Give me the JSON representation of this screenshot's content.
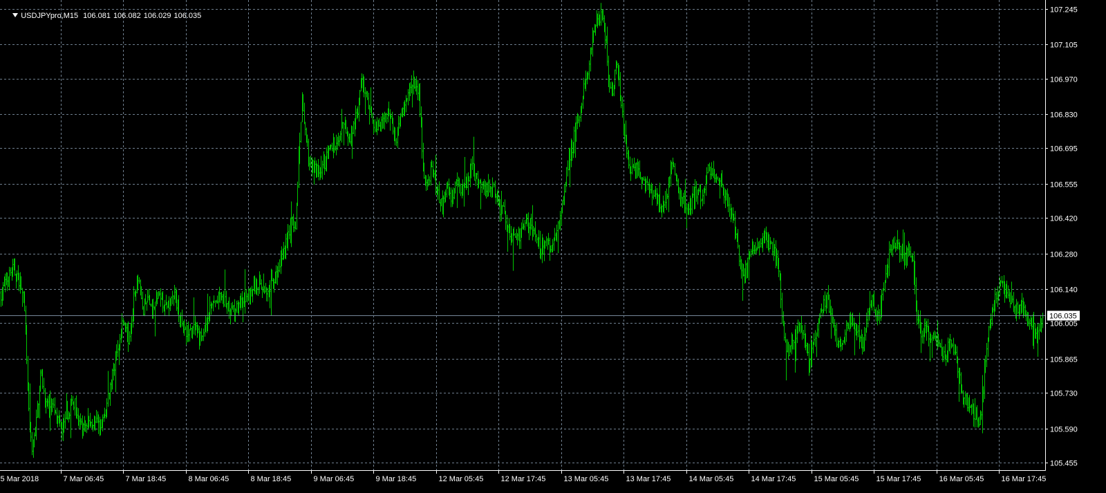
{
  "header": {
    "symbol": "USDJPYpro,M15",
    "open": "106.081",
    "high": "106.082",
    "low": "106.029",
    "close": "106.035"
  },
  "colors": {
    "background": "#000000",
    "bars": "#00c800",
    "grid": "#708090",
    "axis_text": "#ffffff",
    "price_line": "#778899"
  },
  "chart_data": {
    "type": "ohlc",
    "timeframe": "M15",
    "grid": true,
    "current_price": 106.035,
    "current_price_label": "106.035",
    "y_ticks": [
      "107.245",
      "107.105",
      "106.970",
      "106.830",
      "106.695",
      "106.555",
      "106.420",
      "106.280",
      "106.140",
      "106.005",
      "105.865",
      "105.730",
      "105.590",
      "105.455"
    ],
    "ylim": [
      105.425,
      107.28
    ],
    "x_ticks": [
      "5 Mar 2018",
      "7 Mar 06:45",
      "7 Mar 18:45",
      "8 Mar 06:45",
      "8 Mar 18:45",
      "9 Mar 06:45",
      "9 Mar 18:45",
      "12 Mar 05:45",
      "12 Mar 17:45",
      "13 Mar 05:45",
      "13 Mar 17:45",
      "14 Mar 05:45",
      "14 Mar 17:45",
      "15 Mar 05:45",
      "15 Mar 17:45",
      "16 Mar 05:45",
      "16 Mar 17:45"
    ],
    "price_path": [
      [
        0,
        106.12
      ],
      [
        1.5,
        106.22
      ],
      [
        2.5,
        106.17
      ],
      [
        3.0,
        106.08
      ],
      [
        3.5,
        105.72
      ],
      [
        4.0,
        105.48
      ],
      [
        4.6,
        105.62
      ],
      [
        5.2,
        105.82
      ],
      [
        5.8,
        105.68
      ],
      [
        6.5,
        105.7
      ],
      [
        7.2,
        105.62
      ],
      [
        8.0,
        105.58
      ],
      [
        8.8,
        105.66
      ],
      [
        9.6,
        105.7
      ],
      [
        10.5,
        105.58
      ],
      [
        11.5,
        105.62
      ],
      [
        12.6,
        105.6
      ],
      [
        13.5,
        105.64
      ],
      [
        14.2,
        105.76
      ],
      [
        15.0,
        105.88
      ],
      [
        15.5,
        105.98
      ],
      [
        16.0,
        106.02
      ],
      [
        16.6,
        105.92
      ],
      [
        17.2,
        106.1
      ],
      [
        17.8,
        106.2
      ],
      [
        18.4,
        106.04
      ],
      [
        19.0,
        106.1
      ],
      [
        19.8,
        106.06
      ],
      [
        20.4,
        106.12
      ],
      [
        21.4,
        106.06
      ],
      [
        22.4,
        106.12
      ],
      [
        23.2,
        106.04
      ],
      [
        24.0,
        105.96
      ],
      [
        25.0,
        105.98
      ],
      [
        26.0,
        105.94
      ],
      [
        27.0,
        106.06
      ],
      [
        28.2,
        106.1
      ],
      [
        29.5,
        106.08
      ],
      [
        30.8,
        106.06
      ],
      [
        32.0,
        106.12
      ],
      [
        33.3,
        106.16
      ],
      [
        34.5,
        106.14
      ],
      [
        35.5,
        106.18
      ],
      [
        36.3,
        106.26
      ],
      [
        37.0,
        106.32
      ],
      [
        37.6,
        106.4
      ],
      [
        38.2,
        106.38
      ],
      [
        38.8,
        106.74
      ],
      [
        39.0,
        106.88
      ],
      [
        39.3,
        106.78
      ],
      [
        40.0,
        106.64
      ],
      [
        40.8,
        106.62
      ],
      [
        41.5,
        106.6
      ],
      [
        42.4,
        106.68
      ],
      [
        43.4,
        106.72
      ],
      [
        44.4,
        106.78
      ],
      [
        45.4,
        106.74
      ],
      [
        46.3,
        106.86
      ],
      [
        46.8,
        106.96
      ],
      [
        47.3,
        106.9
      ],
      [
        47.9,
        106.82
      ],
      [
        48.5,
        106.78
      ],
      [
        49.3,
        106.8
      ],
      [
        50.1,
        106.84
      ],
      [
        50.6,
        106.82
      ],
      [
        51.2,
        106.72
      ],
      [
        51.9,
        106.84
      ],
      [
        52.6,
        106.86
      ],
      [
        53.2,
        106.96
      ],
      [
        53.8,
        106.94
      ],
      [
        54.2,
        106.92
      ],
      [
        54.8,
        106.56
      ],
      [
        55.4,
        106.58
      ],
      [
        56.0,
        106.62
      ],
      [
        56.6,
        106.52
      ],
      [
        57.2,
        106.46
      ],
      [
        57.8,
        106.54
      ],
      [
        58.4,
        106.5
      ],
      [
        59.0,
        106.56
      ],
      [
        59.6,
        106.52
      ],
      [
        60.2,
        106.54
      ],
      [
        61.0,
        106.62
      ],
      [
        61.6,
        106.58
      ],
      [
        62.2,
        106.56
      ],
      [
        62.8,
        106.54
      ],
      [
        63.5,
        106.56
      ],
      [
        64.0,
        106.52
      ],
      [
        64.6,
        106.46
      ],
      [
        65.2,
        106.44
      ],
      [
        65.8,
        106.38
      ],
      [
        66.6,
        106.34
      ],
      [
        67.4,
        106.36
      ],
      [
        68.0,
        106.4
      ],
      [
        68.8,
        106.38
      ],
      [
        69.4,
        106.36
      ],
      [
        70.0,
        106.3
      ],
      [
        70.6,
        106.32
      ],
      [
        71.4,
        106.3
      ],
      [
        72.1,
        106.38
      ],
      [
        72.8,
        106.48
      ],
      [
        73.4,
        106.62
      ],
      [
        74.0,
        106.7
      ],
      [
        74.8,
        106.8
      ],
      [
        75.5,
        106.92
      ],
      [
        76.2,
        107.0
      ],
      [
        76.7,
        107.16
      ],
      [
        77.3,
        107.2
      ],
      [
        77.8,
        107.22
      ],
      [
        78.3,
        107.16
      ],
      [
        78.8,
        106.96
      ],
      [
        79.3,
        106.92
      ],
      [
        79.9,
        107.04
      ],
      [
        80.4,
        106.86
      ],
      [
        81.0,
        106.72
      ],
      [
        81.6,
        106.6
      ],
      [
        82.2,
        106.62
      ],
      [
        82.8,
        106.58
      ],
      [
        83.4,
        106.56
      ],
      [
        84.0,
        106.54
      ],
      [
        84.6,
        106.52
      ],
      [
        85.2,
        106.48
      ],
      [
        85.8,
        106.46
      ],
      [
        86.4,
        106.5
      ],
      [
        87.0,
        106.66
      ],
      [
        87.6,
        106.56
      ],
      [
        88.2,
        106.5
      ],
      [
        88.8,
        106.48
      ],
      [
        89.4,
        106.46
      ],
      [
        90.0,
        106.52
      ],
      [
        90.6,
        106.5
      ],
      [
        91.2,
        106.54
      ],
      [
        91.8,
        106.62
      ],
      [
        92.4,
        106.6
      ],
      [
        93.0,
        106.56
      ],
      [
        93.6,
        106.54
      ],
      [
        94.2,
        106.48
      ],
      [
        94.8,
        106.42
      ],
      [
        95.4,
        106.34
      ],
      [
        96.0,
        106.2
      ],
      [
        96.6,
        106.22
      ],
      [
        97.2,
        106.28
      ],
      [
        97.8,
        106.3
      ],
      [
        98.4,
        106.32
      ],
      [
        99.0,
        106.34
      ],
      [
        99.6,
        106.32
      ],
      [
        100.2,
        106.3
      ],
      [
        100.8,
        106.22
      ],
      [
        101.4,
        106.0
      ],
      [
        101.8,
        105.88
      ],
      [
        102.4,
        105.92
      ],
      [
        103.0,
        105.96
      ],
      [
        103.6,
        106.0
      ],
      [
        104.2,
        105.94
      ],
      [
        104.8,
        105.84
      ],
      [
        105.3,
        105.92
      ],
      [
        105.9,
        106.0
      ],
      [
        106.5,
        106.08
      ],
      [
        107.1,
        106.1
      ],
      [
        107.6,
        106.04
      ],
      [
        108.2,
        105.96
      ],
      [
        108.8,
        105.9
      ],
      [
        109.4,
        105.96
      ],
      [
        110.0,
        106.02
      ],
      [
        110.6,
        106.0
      ],
      [
        111.2,
        105.96
      ],
      [
        111.8,
        105.92
      ],
      [
        112.4,
        106.06
      ],
      [
        113.0,
        106.12
      ],
      [
        113.6,
        106.0
      ],
      [
        114.2,
        106.1
      ],
      [
        114.8,
        106.22
      ],
      [
        115.3,
        106.3
      ],
      [
        115.8,
        106.32
      ],
      [
        116.4,
        106.3
      ],
      [
        117.0,
        106.26
      ],
      [
        117.6,
        106.28
      ],
      [
        118.2,
        106.24
      ],
      [
        118.8,
        106.02
      ],
      [
        119.4,
        105.96
      ],
      [
        120.0,
        105.98
      ],
      [
        120.6,
        105.94
      ],
      [
        121.2,
        105.92
      ],
      [
        121.8,
        105.9
      ],
      [
        122.4,
        105.88
      ],
      [
        123.0,
        105.92
      ],
      [
        123.6,
        105.9
      ],
      [
        124.2,
        105.8
      ],
      [
        124.8,
        105.72
      ],
      [
        125.4,
        105.68
      ],
      [
        126.0,
        105.66
      ],
      [
        126.6,
        105.62
      ],
      [
        127.1,
        105.64
      ],
      [
        127.6,
        105.86
      ],
      [
        128.1,
        106.0
      ],
      [
        128.6,
        106.08
      ],
      [
        129.2,
        106.14
      ],
      [
        129.8,
        106.16
      ],
      [
        130.4,
        106.12
      ],
      [
        131.0,
        106.08
      ],
      [
        131.6,
        106.06
      ],
      [
        132.2,
        106.08
      ],
      [
        132.8,
        106.04
      ],
      [
        133.4,
        106.02
      ],
      [
        134.0,
        105.98
      ],
      [
        134.6,
        105.96
      ],
      [
        135.0,
        106.035
      ]
    ]
  }
}
